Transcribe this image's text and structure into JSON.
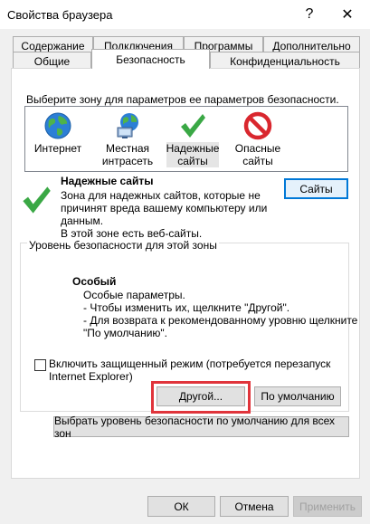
{
  "window": {
    "title": "Свойства браузера",
    "help_glyph": "?",
    "close_glyph": "✕"
  },
  "tabs": {
    "row1": [
      "Содержание",
      "Подключения",
      "Программы",
      "Дополнительно"
    ],
    "row2": [
      "Общие",
      "Безопасность",
      "Конфиденциальность"
    ],
    "active": "Безопасность"
  },
  "zones": {
    "prompt": "Выберите зону для параметров ее параметров безопасности.",
    "items": [
      {
        "label": "Интернет",
        "icon": "globe-icon"
      },
      {
        "label": "Местная\nинтрасеть",
        "icon": "intranet-icon"
      },
      {
        "label": "Надежные\nсайты",
        "icon": "checkmark-icon"
      },
      {
        "label": "Опасные\nсайты",
        "icon": "prohibited-icon"
      }
    ],
    "selected": "Надежные сайты"
  },
  "zone_info": {
    "title": "Надежные сайты",
    "line1": "Зона для надежных сайтов, которые не",
    "line2": "причинят вреда вашему компьютеру или",
    "line3": "данным.",
    "line4": "В этой зоне есть веб-сайты.",
    "sites_button": "Сайты"
  },
  "security_level": {
    "legend": "Уровень безопасности для этой зоны",
    "name": "Особый",
    "line1": "Особые параметры.",
    "line2": "- Чтобы изменить их, щелкните \"Другой\".",
    "line3": "- Для возврата к рекомендованному уровню щелкните",
    "line4": "\"По умолчанию\"."
  },
  "protected_mode": {
    "line1": "Включить защищенный режим (потребуется перезапуск",
    "line2": "Internet Explorer)",
    "checked": false
  },
  "buttons": {
    "other": "Другой...",
    "default": "По умолчанию",
    "default_all": "Выбрать уровень безопасности по умолчанию для всех зон",
    "ok": "ОК",
    "cancel": "Отмена",
    "apply": "Применить"
  },
  "colors": {
    "accent": "#0078d7",
    "highlight": "#e0343b",
    "check_green": "#3aa845",
    "prohibited_red": "#d9272e"
  }
}
